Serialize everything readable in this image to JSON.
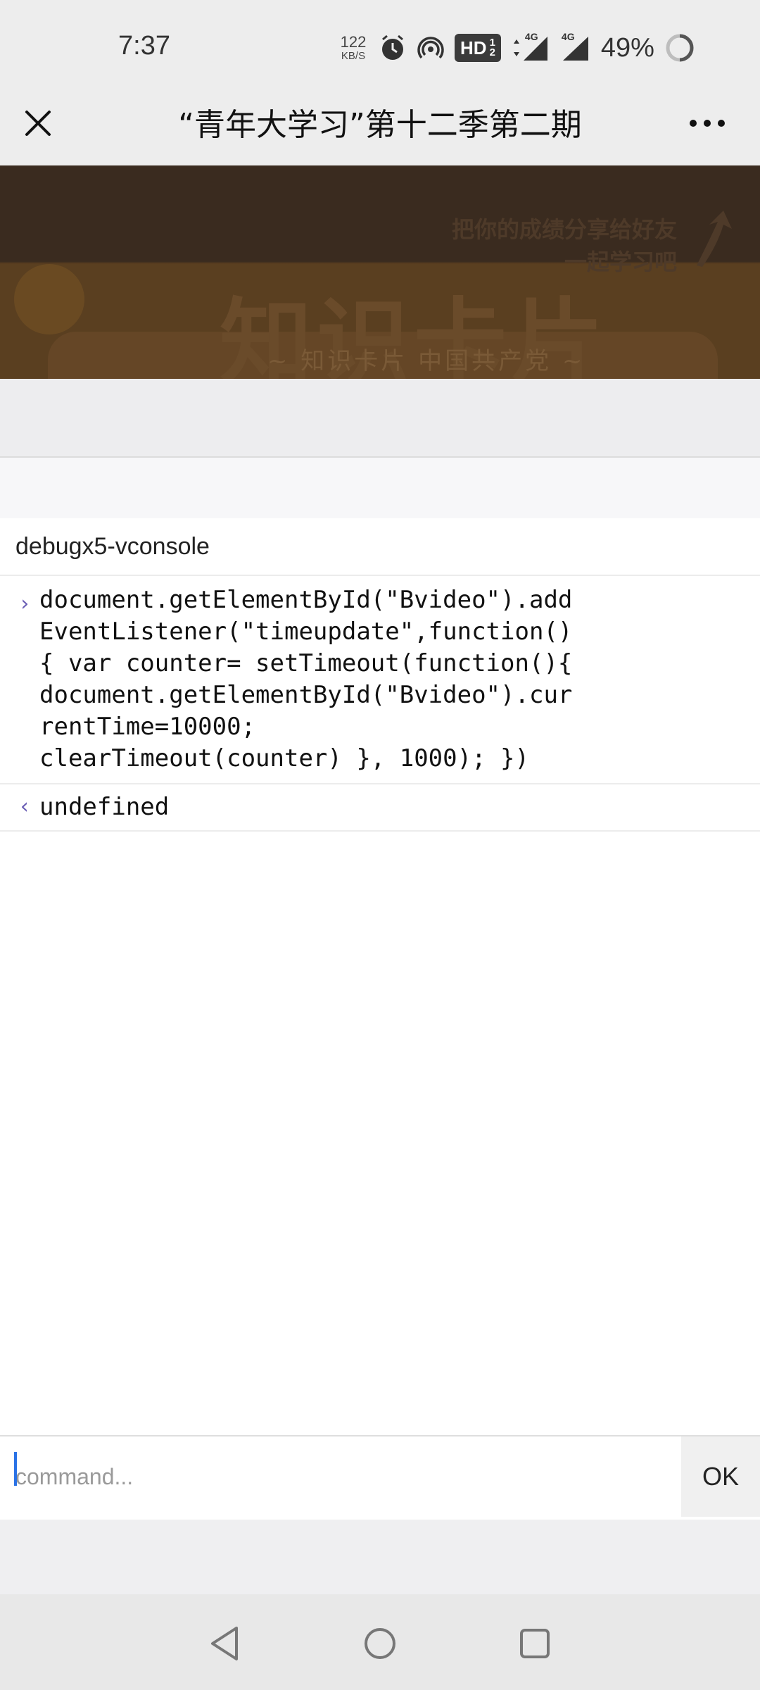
{
  "status_bar": {
    "time": "7:37",
    "net_speed_value": "122",
    "net_speed_unit": "KB/S",
    "hd_label": "HD",
    "hd_sub_top": "1",
    "hd_sub_bottom": "2",
    "signal1_label": "4G",
    "signal2_label": "4G",
    "battery_percent": "49%",
    "icons": [
      "alarm-icon",
      "hotspot-icon",
      "hd-icon",
      "signal-icon",
      "signal-icon",
      "battery-icon"
    ]
  },
  "title_bar": {
    "title": "“青年大学习”第十二季第二期",
    "close_icon": "close-icon",
    "more_icon": "more-icon"
  },
  "banner": {
    "share_line1": "把你的成绩分享给好友",
    "share_line2": "一起学习吧",
    "title": "知识卡片",
    "subtitle": "~ 知识卡片 中国共产党 ~"
  },
  "console": {
    "header": "debugx5-vconsole",
    "entries": [
      {
        "type": "input",
        "marker": "›",
        "text": "document.getElementById(\"Bvideo\").add\nEventListener(\"timeupdate\",function()\n{ var counter= setTimeout(function(){\ndocument.getElementById(\"Bvideo\").cur\nrentTime=10000;\nclearTimeout(counter) }, 1000); })"
      },
      {
        "type": "output",
        "marker": "‹",
        "text": "undefined"
      }
    ]
  },
  "command_bar": {
    "placeholder": "command...",
    "ok_label": "OK"
  },
  "nav_bar": {
    "icons": [
      "back-icon",
      "home-icon",
      "recents-icon"
    ]
  }
}
